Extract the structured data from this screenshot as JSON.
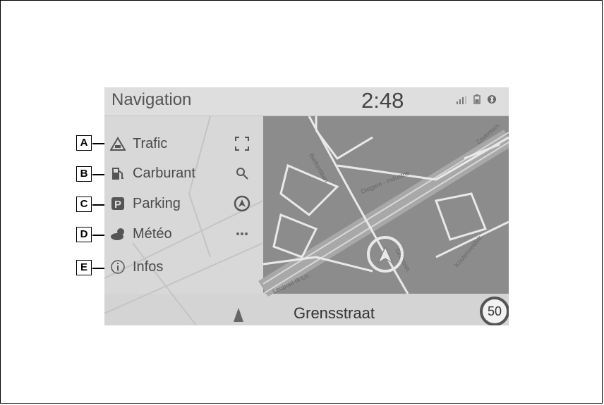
{
  "header": {
    "title": "Navigation",
    "clock": "2:48"
  },
  "menu": [
    {
      "callout": "A",
      "label": "Trafic",
      "icon": "traffic-warning-icon"
    },
    {
      "callout": "B",
      "label": "Carburant",
      "icon": "fuel-pump-icon"
    },
    {
      "callout": "C",
      "label": "Parking",
      "icon": "parking-icon"
    },
    {
      "callout": "D",
      "label": "Météo",
      "icon": "weather-icon"
    },
    {
      "callout": "E",
      "label": "Infos",
      "icon": "info-icon"
    }
  ],
  "side_buttons": [
    "fullscreen-icon",
    "search-icon",
    "compass-icon",
    "more-icon"
  ],
  "map": {
    "streets": [
      "Berkenlaan",
      "Diegem - Industrie",
      "Grensstr.",
      "Koutenveldstr.",
      "Leopold III Ln.",
      "Zaventem"
    ],
    "current_street": "Grensstraat",
    "speed_limit": "50"
  },
  "colors": {
    "screen_bg": "#cfcfcf",
    "topbar_bg": "#dedede",
    "text": "#4a4a4a"
  }
}
